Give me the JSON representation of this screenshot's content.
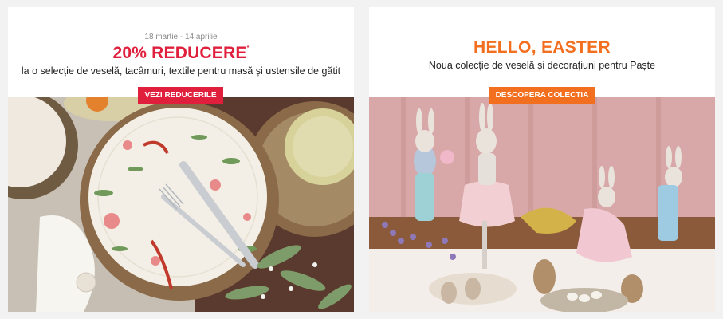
{
  "banners": [
    {
      "date_range": "18 martie - 14 aprilie",
      "headline": "20% REDUCERE",
      "headline_mark": "*",
      "subtitle": "la o selecție de veselă, tacâmuri, textile pentru masă și ustensile de gătit",
      "cta_label": "VEZI REDUCERILE",
      "accent_color": "#e01f3d"
    },
    {
      "headline": "HELLO, EASTER",
      "subtitle": "Noua colecție de veselă și decorațiuni pentru Paște",
      "cta_label": "DESCOPERA COLECTIA",
      "accent_color": "#f36f20"
    }
  ]
}
